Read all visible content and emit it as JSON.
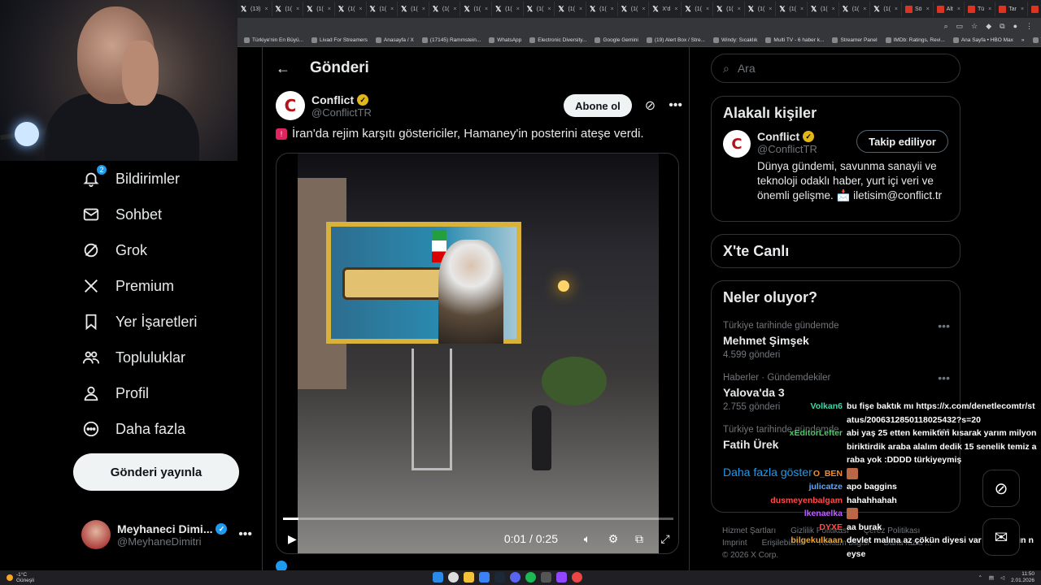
{
  "browser": {
    "tabs": [
      {
        "label": "(13)",
        "icon": "x"
      },
      {
        "label": "(1(",
        "icon": "x"
      },
      {
        "label": "(1(",
        "icon": "x"
      },
      {
        "label": "(1(",
        "icon": "x"
      },
      {
        "label": "(1(",
        "icon": "x"
      },
      {
        "label": "(1(",
        "icon": "x"
      },
      {
        "label": "(1(",
        "icon": "x"
      },
      {
        "label": "(1(",
        "icon": "x"
      },
      {
        "label": "(1(",
        "icon": "x"
      },
      {
        "label": "(1(",
        "icon": "x"
      },
      {
        "label": "(1(",
        "icon": "x"
      },
      {
        "label": "(1(",
        "icon": "x"
      },
      {
        "label": "(1(",
        "icon": "x"
      },
      {
        "label": "X'd",
        "icon": "x"
      },
      {
        "label": "(1(",
        "icon": "x"
      },
      {
        "label": "(1(",
        "icon": "x"
      },
      {
        "label": "(1(",
        "icon": "x"
      },
      {
        "label": "(1(",
        "icon": "x"
      },
      {
        "label": "(1(",
        "icon": "x"
      },
      {
        "label": "(1(",
        "icon": "x"
      },
      {
        "label": "(1(",
        "icon": "x"
      },
      {
        "label": "Sö",
        "icon": "red"
      },
      {
        "label": "Alt",
        "icon": "red"
      },
      {
        "label": "Tü",
        "icon": "red"
      },
      {
        "label": "Tar",
        "icon": "red"
      },
      {
        "label": "He",
        "icon": "red"
      },
      {
        "label": "X'l",
        "icon": "x"
      }
    ],
    "bookmarks": [
      "Türkiye'nin En Büyü...",
      "Livad For Streamers",
      "Anasayfa / X",
      "(17145) Rammstein...",
      "WhatsApp",
      "Electronic Diversity...",
      "Google Gemini",
      "(19) Alert Box / Stre...",
      "Windy: Sıcaklık",
      "Multi TV - 6 haber k...",
      "Streamer Panel",
      "IMDb: Ratings, Revi...",
      "Ana Sayfa • HBO Max"
    ],
    "bookmarks_more": "»",
    "all_bookmarks": "Tüm Yer İşaretleri"
  },
  "nav": {
    "items": [
      {
        "label": "Bildirimler",
        "icon": "bell-icon",
        "badge": "2"
      },
      {
        "label": "Sohbet",
        "icon": "mail-icon"
      },
      {
        "label": "Grok",
        "icon": "grok-icon"
      },
      {
        "label": "Premium",
        "icon": "x-logo-icon"
      },
      {
        "label": "Yer İşaretleri",
        "icon": "bookmark-icon"
      },
      {
        "label": "Topluluklar",
        "icon": "people-icon"
      },
      {
        "label": "Profil",
        "icon": "person-icon"
      },
      {
        "label": "Daha fazla",
        "icon": "more-circle-icon"
      }
    ],
    "post_button": "Gönderi yayınla",
    "user": {
      "name": "Meyhaneci Dimi...",
      "handle": "@MeyhaneDimitri"
    }
  },
  "post": {
    "header_title": "Gönderi",
    "author_name": "Conflict",
    "author_handle": "@ConflictTR",
    "subscribe": "Abone ol",
    "text": "İran'da rejim karşıtı göstericiler, Hamaney'in posterini ateşe verdi.",
    "video": {
      "time": "0:01 / 0:25",
      "progress": 0.04
    }
  },
  "right": {
    "search_placeholder": "Ara",
    "related": {
      "title": "Alakalı kişiler",
      "name": "Conflict",
      "handle": "@ConflictTR",
      "button": "Takip ediliyor",
      "desc": "Dünya gündemi, savunma sanayii ve teknoloji odaklı haber, yurt içi veri ve önemli gelişme. 📩 iletisim@conflict.tr"
    },
    "live": {
      "title": "X'te Canlı"
    },
    "trends": {
      "title": "Neler oluyor?",
      "items": [
        {
          "context": "Türkiye tarihinde gündemde",
          "title": "Mehmet Şimşek",
          "count": "4.599 gönderi"
        },
        {
          "context": "Haberler · Gündemdekiler",
          "title": "Yalova'da 3",
          "count": "2.755 gönderi"
        },
        {
          "context": "Türkiye tarihinde gündemde",
          "title": "Fatih Ürek",
          "count": ""
        }
      ],
      "show_more": "Daha fazla göster"
    },
    "footer": [
      "Hizmet Şartları",
      "Gizlilik Politikası",
      "Çerez Politikası",
      "Imprint",
      "Erişilebilirlik",
      "Reklam bilgisi",
      "Daha fazla ...",
      "© 2026 X Corp."
    ]
  },
  "chat": [
    {
      "user": "Volkan6",
      "color": "#3fd6a8",
      "text": "bu fişe baktık mı https://x.com/denetlecomtr/status/2006312850118025432?s=20"
    },
    {
      "user": "xEditorLefter",
      "color": "#4ec96b",
      "text": "abi yaş 25 etten kemikten kısarak yarım milyon biriktirdik araba alalım dedik 15 senelik temiz araba yok :DDDD türkiyeymiş"
    },
    {
      "user": "O_BEN",
      "color": "#f28c28",
      "text": "",
      "emote": true
    },
    {
      "user": "julicatze",
      "color": "#5aa9ff",
      "text": "apo baggins"
    },
    {
      "user": "dusmeyenbalgam",
      "color": "#ff4a4a",
      "text": "hahahhahah"
    },
    {
      "user": "lkenaelka",
      "color": "#c061ff",
      "text": "",
      "emote": true
    },
    {
      "user": "DYXE",
      "color": "#ff4a4a",
      "text": "aa burak"
    },
    {
      "user": "bilgekulkaan",
      "color": "#f2a62b",
      "text": "devlet malına az çökün diyesi var da insanın neyse"
    }
  ],
  "taskbar": {
    "temp": "-1°C",
    "weather": "Güneşli",
    "time": "11:50",
    "date": "2.01.2026"
  },
  "colors": {
    "accent": "#1d9bf0",
    "verified_gold": "#e2b719",
    "background": "#000000"
  }
}
